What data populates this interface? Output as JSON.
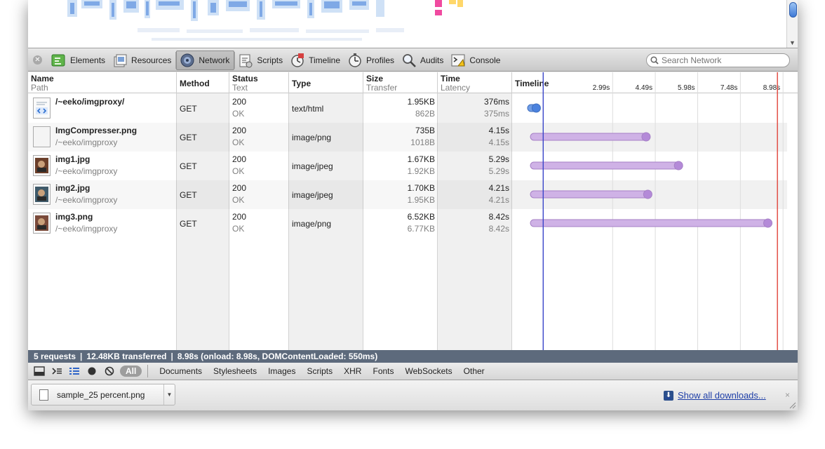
{
  "toolbar": {
    "tabs": [
      {
        "label": "Elements",
        "icon": "elements-icon"
      },
      {
        "label": "Resources",
        "icon": "resources-icon"
      },
      {
        "label": "Network",
        "icon": "network-icon",
        "active": true
      },
      {
        "label": "Scripts",
        "icon": "scripts-icon"
      },
      {
        "label": "Timeline",
        "icon": "timeline-icon"
      },
      {
        "label": "Profiles",
        "icon": "profiles-icon"
      },
      {
        "label": "Audits",
        "icon": "audits-icon"
      },
      {
        "label": "Console",
        "icon": "console-icon"
      }
    ],
    "search_placeholder": "Search Network"
  },
  "columns": {
    "name": "Name",
    "path": "Path",
    "method": "Method",
    "status": "Status",
    "text": "Text",
    "type": "Type",
    "size": "Size",
    "transfer": "Transfer",
    "time": "Time",
    "latency": "Latency",
    "timeline": "Timeline",
    "ticks": [
      "2.99s",
      "4.49s",
      "5.98s",
      "7.48s",
      "8.98s"
    ]
  },
  "requests": [
    {
      "name": "/~eeko/imgproxy/",
      "path": "",
      "method": "GET",
      "status": "200",
      "status_text": "OK",
      "type": "text/html",
      "size": "1.95KB",
      "transfer": "862B",
      "time": "376ms",
      "latency": "375ms",
      "start_s": 0.0,
      "end_s": 0.38,
      "kind": "doc"
    },
    {
      "name": "ImgCompresser.png",
      "path": "/~eeko/imgproxy",
      "method": "GET",
      "status": "200",
      "status_text": "OK",
      "type": "image/png",
      "size": "735B",
      "transfer": "1018B",
      "time": "4.15s",
      "latency": "4.15s",
      "start_s": 0.1,
      "end_s": 4.24,
      "kind": "img"
    },
    {
      "name": "img1.jpg",
      "path": "/~eeko/imgproxy",
      "method": "GET",
      "status": "200",
      "status_text": "OK",
      "type": "image/jpeg",
      "size": "1.67KB",
      "transfer": "1.92KB",
      "time": "5.29s",
      "latency": "5.29s",
      "start_s": 0.1,
      "end_s": 5.38,
      "kind": "img"
    },
    {
      "name": "img2.jpg",
      "path": "/~eeko/imgproxy",
      "method": "GET",
      "status": "200",
      "status_text": "OK",
      "type": "image/jpeg",
      "size": "1.70KB",
      "transfer": "1.95KB",
      "time": "4.21s",
      "latency": "4.21s",
      "start_s": 0.1,
      "end_s": 4.3,
      "kind": "img"
    },
    {
      "name": "img3.png",
      "path": "/~eeko/imgproxy",
      "method": "GET",
      "status": "200",
      "status_text": "OK",
      "type": "image/png",
      "size": "6.52KB",
      "transfer": "6.77KB",
      "time": "8.42s",
      "latency": "8.42s",
      "start_s": 0.1,
      "end_s": 8.52,
      "kind": "img"
    }
  ],
  "timeline": {
    "domcontentloaded_s": 0.55,
    "onload_s": 8.98,
    "colors": {
      "doc": "#6f9de6",
      "img": "#cfb2e6",
      "dcl_line": "#3a45c9",
      "onload_line": "#e0443b"
    }
  },
  "status_bar": {
    "requests": "5 requests",
    "transferred": "12.48KB transferred",
    "timing": "8.98s (onload: 8.98s, DOMContentLoaded: 550ms)"
  },
  "filters": {
    "all": "All",
    "items": [
      "Documents",
      "Stylesheets",
      "Images",
      "Scripts",
      "XHR",
      "Fonts",
      "WebSockets",
      "Other"
    ]
  },
  "downloads": {
    "file": "sample_25 percent.png",
    "show_all": "Show all downloads...",
    "close": "×"
  }
}
